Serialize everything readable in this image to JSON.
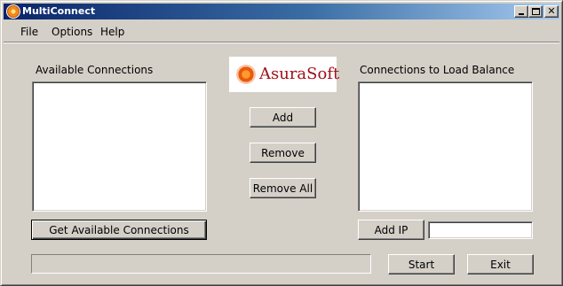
{
  "window": {
    "title": "MultiConnect",
    "icon": "app-sun-icon"
  },
  "menubar": {
    "items": [
      "File",
      "Options",
      "Help"
    ]
  },
  "left_panel": {
    "label": "Available Connections",
    "items": [],
    "get_button_label": "Get Available Connections"
  },
  "right_panel": {
    "label": "Connections to Load Balance",
    "items": [],
    "add_ip_label": "Add IP",
    "ip_value": "",
    "ip_placeholder": ""
  },
  "center": {
    "logo_text": "AsuraSoft",
    "add_label": "Add",
    "remove_label": "Remove",
    "remove_all_label": "Remove All"
  },
  "footer": {
    "progress": 0,
    "start_label": "Start",
    "exit_label": "Exit"
  },
  "colors": {
    "titlebar_start": "#0a246a",
    "titlebar_end": "#a6caf0",
    "face": "#d4d0c8",
    "logo_text": "#a0101a"
  }
}
